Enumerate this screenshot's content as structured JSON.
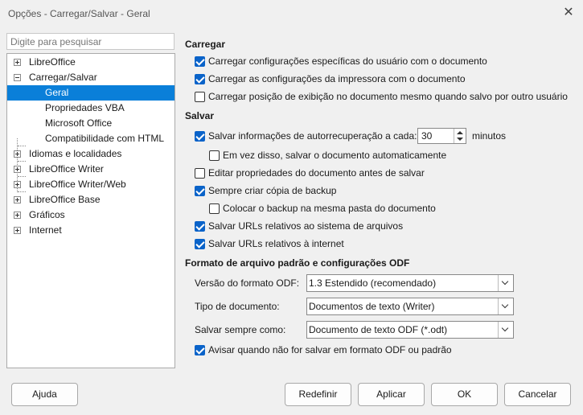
{
  "window": {
    "title": "Opções - Carregar/Salvar - Geral"
  },
  "search": {
    "placeholder": "Digite para pesquisar"
  },
  "tree": {
    "items": [
      {
        "label": "LibreOffice",
        "expander": "plus"
      },
      {
        "label": "Carregar/Salvar",
        "expander": "minus"
      },
      {
        "label": "Geral",
        "selected": true
      },
      {
        "label": "Propriedades VBA"
      },
      {
        "label": "Microsoft Office"
      },
      {
        "label": "Compatibilidade com HTML"
      },
      {
        "label": "Idiomas e localidades",
        "expander": "plus"
      },
      {
        "label": "LibreOffice Writer",
        "expander": "plus"
      },
      {
        "label": "LibreOffice Writer/Web",
        "expander": "plus"
      },
      {
        "label": "LibreOffice Base",
        "expander": "plus"
      },
      {
        "label": "Gráficos",
        "expander": "plus"
      },
      {
        "label": "Internet",
        "expander": "plus"
      }
    ]
  },
  "load": {
    "title": "Carregar",
    "options": [
      {
        "label": "Carregar configurações específicas do usuário com o documento",
        "checked": true
      },
      {
        "label": "Carregar as configurações da impressora com o documento",
        "checked": true
      },
      {
        "label": "Carregar posição de exibição no documento mesmo quando salvo por outro usuário",
        "checked": false
      }
    ]
  },
  "save": {
    "title": "Salvar",
    "autorecovery": {
      "label": "Salvar informações de autorrecuperação a cada:",
      "checked": true,
      "value": "30",
      "unit": "minutos"
    },
    "autosave": {
      "label": "Em vez disso, salvar o documento automaticamente",
      "checked": false
    },
    "edit_props": {
      "label": "Editar propriedades do documento antes de salvar",
      "checked": false
    },
    "backup": {
      "label": "Sempre criar cópia de backup",
      "checked": true
    },
    "backup_same_folder": {
      "label": "Colocar o backup na mesma pasta do documento",
      "checked": false
    },
    "relative_fs": {
      "label": "Salvar URLs relativos ao sistema de arquivos",
      "checked": true
    },
    "relative_internet": {
      "label": "Salvar URLs relativos à internet",
      "checked": true
    }
  },
  "format": {
    "title": "Formato de arquivo padrão e configurações ODF",
    "odf_version": {
      "label": "Versão do formato ODF:",
      "value": "1.3 Estendido (recomendado)"
    },
    "doc_type": {
      "label": "Tipo de documento:",
      "value": "Documentos de texto (Writer)"
    },
    "always_save_as": {
      "label": "Salvar sempre como:",
      "value": "Documento de texto ODF (*.odt)"
    },
    "warn": {
      "label": "Avisar quando não for salvar em formato ODF ou padrão",
      "checked": true
    }
  },
  "buttons": {
    "help": "Ajuda",
    "reset": "Redefinir",
    "apply": "Aplicar",
    "ok": "OK",
    "cancel": "Cancelar"
  }
}
